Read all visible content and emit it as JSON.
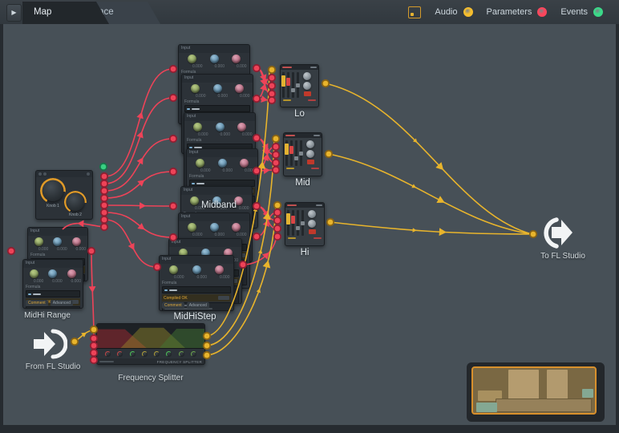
{
  "tabs": [
    {
      "label": "Map",
      "active": true
    },
    {
      "label": "Surface",
      "active": false
    }
  ],
  "legend": {
    "audio_label": "Audio",
    "audio_color": "#e8b42c",
    "parameters_label": "Parameters",
    "parameters_color": "#ee4358",
    "events_label": "Events",
    "events_color": "#38cf82"
  },
  "nodes": {
    "knob_module": {
      "knob1": "Knob 1",
      "knob2": "Knob 2"
    },
    "formula": {
      "header": "Input",
      "section": "Formula",
      "status": "Compiled OK",
      "values": [
        "0.000",
        "0.000",
        "0.000"
      ],
      "footer_left": "Comment",
      "footer_right": "Advanced"
    },
    "splitter": {
      "footer": "FREQUENCY SPLITTER"
    },
    "captions": {
      "midhi_range": "MidHi Range",
      "from_fl": "From FL Studio",
      "freq_splitter": "Frequency Splitter",
      "midhistep": "MidHiStep",
      "midband": "Midband",
      "lo": "Lo",
      "mid": "Mid",
      "hi": "Hi",
      "to_fl": "To FL Studio"
    }
  },
  "colors": {
    "canvas_bg": "#475057",
    "panel_bg": "#2c3238",
    "wire_audio": "#e8b42c",
    "wire_parameters": "#ee4358",
    "port_events": "#38cf82",
    "minimap_border": "#d8902c",
    "knob_arc": "#e09a28"
  }
}
